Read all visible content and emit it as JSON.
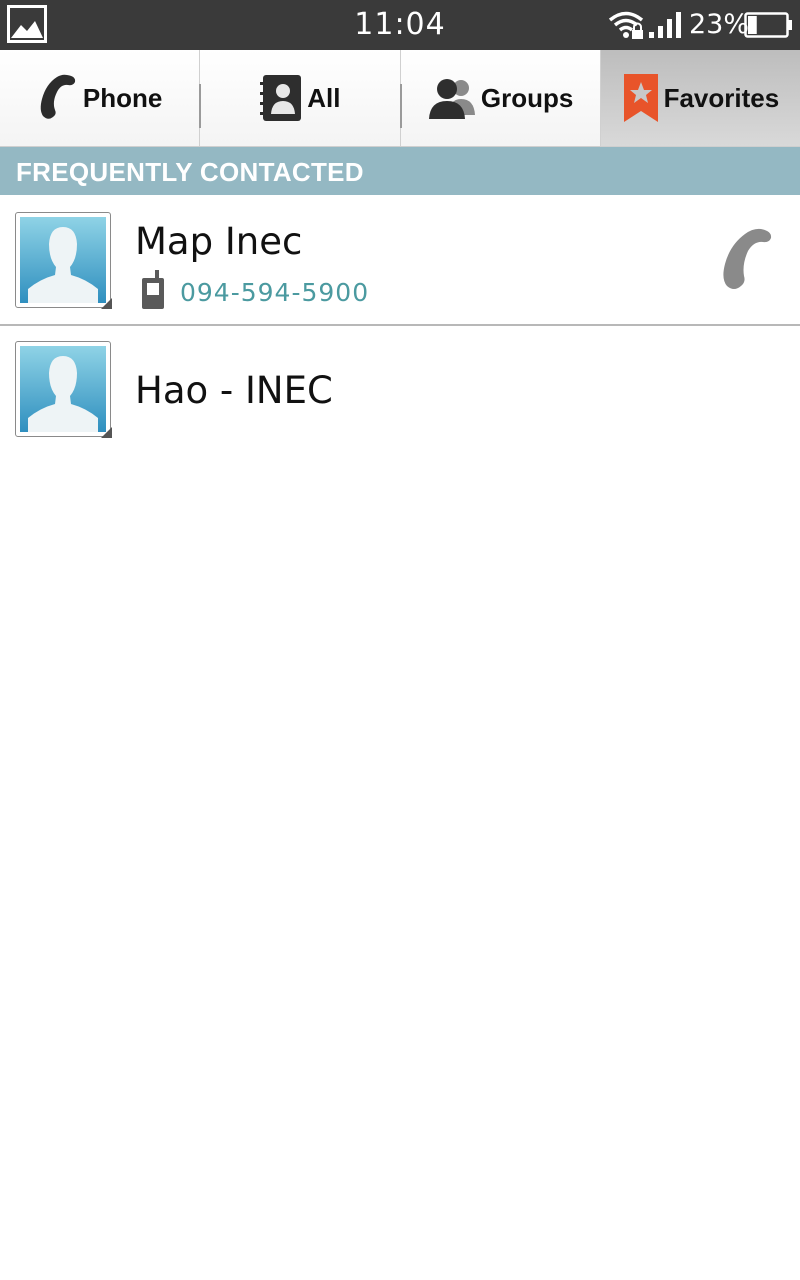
{
  "status_bar": {
    "time": "11:04",
    "battery_percent": "23%",
    "battery_level": 0.23,
    "icons": [
      "gallery-icon",
      "wifi-lock-icon",
      "signal-icon",
      "battery-icon"
    ]
  },
  "tabs": [
    {
      "label": "Phone",
      "icon": "phone-icon",
      "selected": false
    },
    {
      "label": "All",
      "icon": "contacts-book-icon",
      "selected": false
    },
    {
      "label": "Groups",
      "icon": "groups-icon",
      "selected": false
    },
    {
      "label": "Favorites",
      "icon": "favorites-star-icon",
      "selected": true
    }
  ],
  "section": {
    "title": "FREQUENTLY CONTACTED"
  },
  "contacts": [
    {
      "name": "Map Inec",
      "phone": "094-594-5900",
      "phone_type_icon": "mobile-phone-icon",
      "has_call_button": true
    },
    {
      "name": "Hao - INEC"
    }
  ],
  "colors": {
    "status_bar_bg": "#3a3a3a",
    "section_header_bg": "#94b8c3",
    "phone_number": "#4b9aa0",
    "favorites_accent": "#e8542a"
  }
}
